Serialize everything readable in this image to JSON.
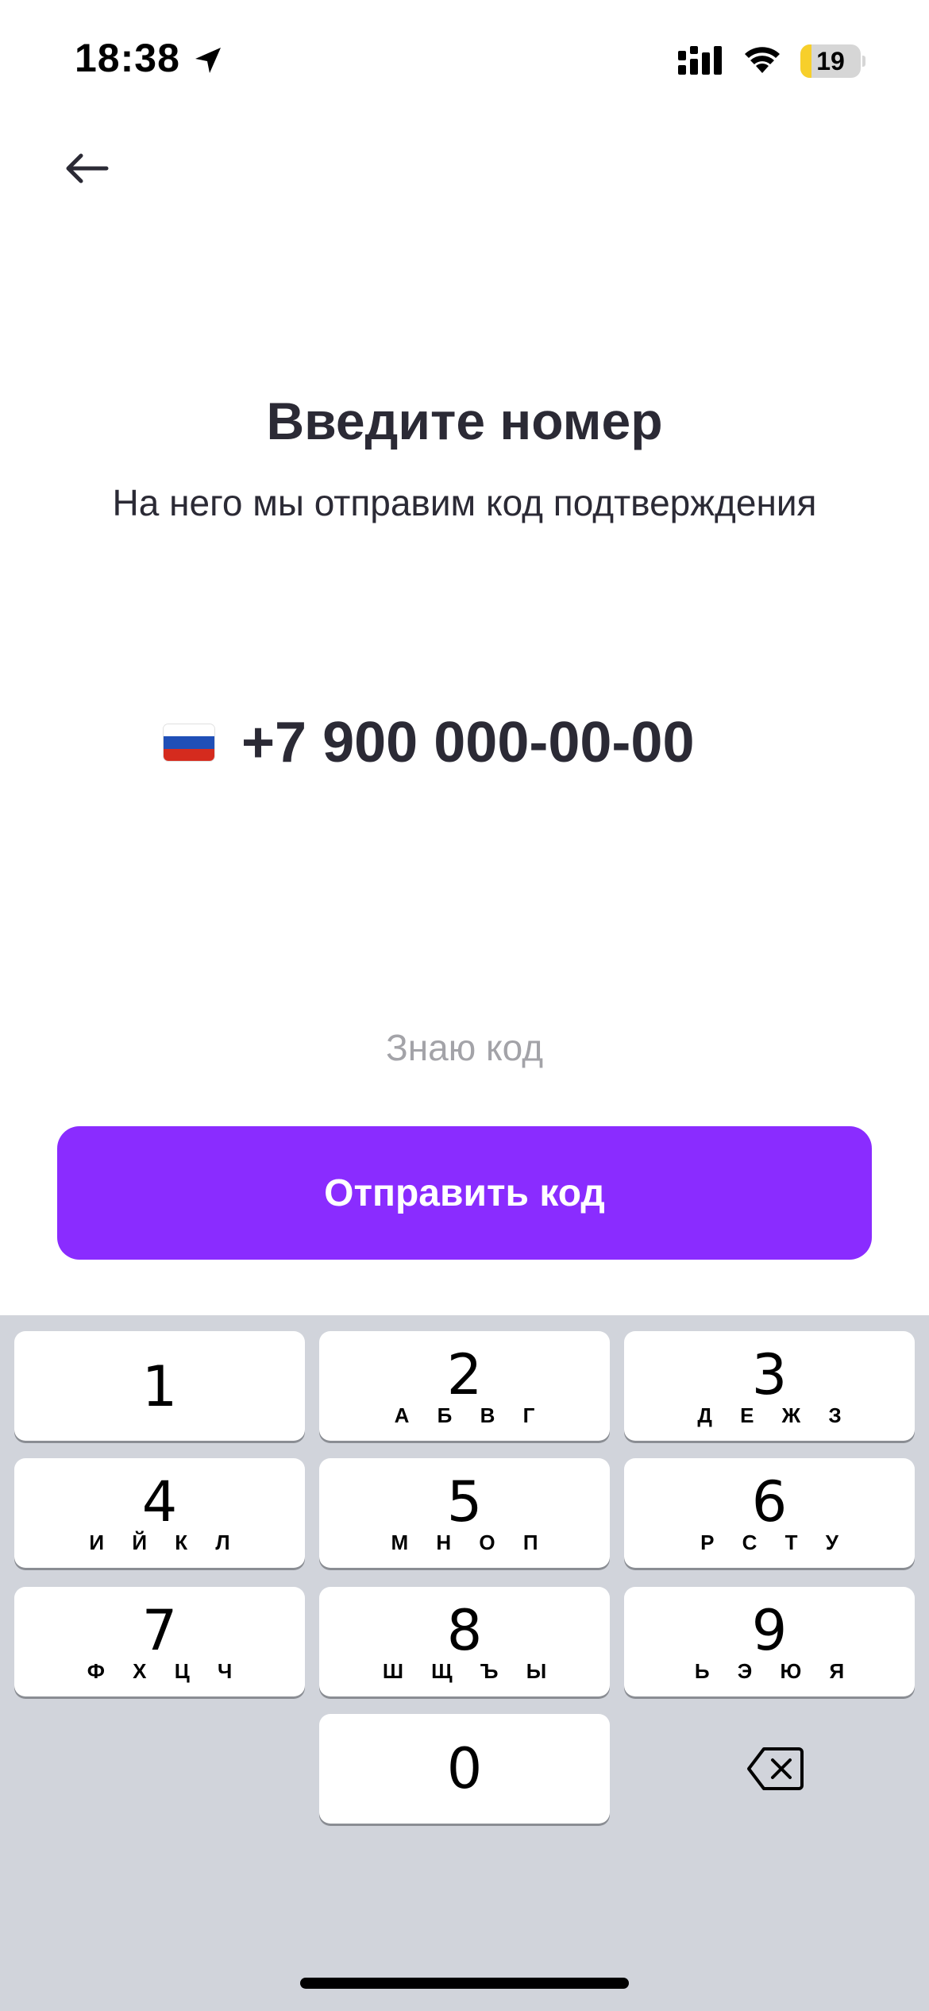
{
  "status_bar": {
    "time": "18:38",
    "battery_level": "19",
    "battery_fraction": 0.19,
    "icons": [
      "location-arrow-icon",
      "cellular-signal-icon",
      "wifi-icon",
      "battery-icon"
    ]
  },
  "nav": {
    "back_icon": "arrow-left-icon"
  },
  "header": {
    "title": "Введите номер",
    "subtitle": "На него мы отправим код подтверждения"
  },
  "phone": {
    "country_flag": "russia-flag-icon",
    "flag_colors": [
      "#ffffff",
      "#1f4fb7",
      "#d52b1e"
    ],
    "placeholder": "+7 900 000-00-00"
  },
  "know_code_label": "Знаю код",
  "send_button_label": "Отправить код",
  "colors": {
    "accent": "#8a2cff",
    "text": "#2b2a35",
    "muted": "#a3a3a8",
    "keyboard_bg": "#d1d4db"
  },
  "keypad": {
    "keys": [
      {
        "digit": "1",
        "letters": ""
      },
      {
        "digit": "2",
        "letters": "А Б В Г"
      },
      {
        "digit": "3",
        "letters": "Д Е Ж З"
      },
      {
        "digit": "4",
        "letters": "И Й К Л"
      },
      {
        "digit": "5",
        "letters": "М Н О П"
      },
      {
        "digit": "6",
        "letters": "Р С Т У"
      },
      {
        "digit": "7",
        "letters": "Ф Х Ц Ч"
      },
      {
        "digit": "8",
        "letters": "Ш Щ Ъ Ы"
      },
      {
        "digit": "9",
        "letters": "Ь Э Ю Я"
      },
      {
        "digit": "0",
        "letters": ""
      }
    ],
    "backspace_icon": "backspace-icon"
  }
}
